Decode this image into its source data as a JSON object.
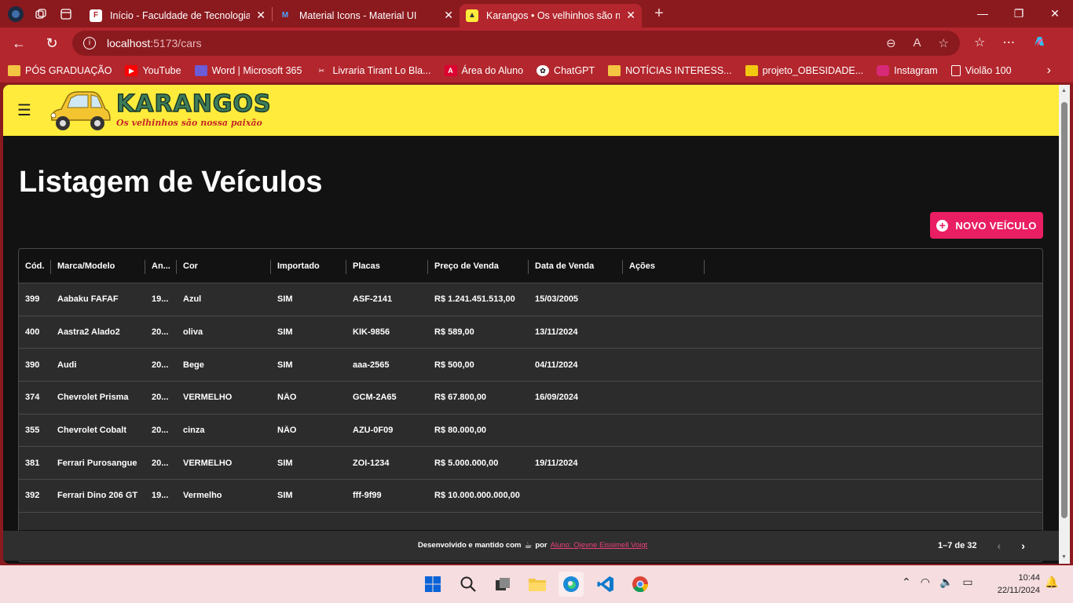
{
  "browser": {
    "tabs": [
      {
        "title": "Início - Faculdade de Tecnologia de",
        "active": false
      },
      {
        "title": "Material Icons - Material UI",
        "active": false
      },
      {
        "title": "Karangos • Os velhinhos são nossa",
        "active": true
      }
    ],
    "url_host": "localhost",
    "url_path": ":5173/cars",
    "bookmarks": [
      "PÓS GRADUAÇÃO",
      "YouTube",
      "Word | Microsoft 365",
      "Livraria Tirant Lo Bla...",
      "Área do Aluno",
      "ChatGPT",
      "NOTÍCIAS INTERESS...",
      "projeto_OBESIDADE...",
      "Instagram",
      "Violão 100"
    ]
  },
  "app": {
    "logo_title": "KARANGOS",
    "logo_slogan": "Os velhinhos são nossa paixão",
    "page_title": "Listagem de Veículos",
    "new_button_label": "NOVO VEÍCULO"
  },
  "grid": {
    "columns": [
      "Cód.",
      "Marca/Modelo",
      "An...",
      "Cor",
      "Importado",
      "Placas",
      "Preço de Venda",
      "Data de Venda",
      "Ações"
    ],
    "rows": [
      {
        "cod": "399",
        "modelo": "Aabaku FAFAF",
        "ano": "19...",
        "cor": "Azul",
        "importado": "SIM",
        "placa": "ASF-2141",
        "preco": "R$ 1.241.451.513,00",
        "data": "15/03/2005"
      },
      {
        "cod": "400",
        "modelo": "Aastra2 Alado2",
        "ano": "20...",
        "cor": "oliva",
        "importado": "SIM",
        "placa": "KIK-9856",
        "preco": "R$ 589,00",
        "data": "13/11/2024"
      },
      {
        "cod": "390",
        "modelo": "Audi",
        "ano": "20...",
        "cor": "Bege",
        "importado": "SIM",
        "placa": "aaa-2565",
        "preco": "R$ 500,00",
        "data": "04/11/2024"
      },
      {
        "cod": "374",
        "modelo": "Chevrolet Prisma",
        "ano": "20...",
        "cor": "VERMELHO",
        "importado": "NÃO",
        "placa": "GCM-2A65",
        "preco": "R$ 67.800,00",
        "data": "16/09/2024"
      },
      {
        "cod": "355",
        "modelo": "Chevrolet Cobalt",
        "ano": "20...",
        "cor": "cinza",
        "importado": "NÃO",
        "placa": "AZU-0F09",
        "preco": "R$ 80.000,00",
        "data": ""
      },
      {
        "cod": "381",
        "modelo": "Ferrari Purosangue",
        "ano": "20...",
        "cor": "VERMELHO",
        "importado": "SIM",
        "placa": "ZOI-1234",
        "preco": "R$ 5.000.000,00",
        "data": "19/11/2024"
      },
      {
        "cod": "392",
        "modelo": "Ferrari Dino 206 GT",
        "ano": "19...",
        "cor": "Vermelho",
        "importado": "SIM",
        "placa": "fff-9f99",
        "preco": "R$ 10.000.000.000,00",
        "data": ""
      }
    ],
    "pagination": "1–7 de 32"
  },
  "footer": {
    "prefix": "Desenvolvido e mantido com",
    "by": "por",
    "author": "Aluno: Ojevne Eissimell Voigt"
  },
  "taskbar": {
    "time": "10:44",
    "date": "22/11/2024"
  },
  "colors": {
    "browser_frame": "#8b1a1f",
    "appbar": "#ffeb3b",
    "accent": "#e91e63",
    "page_bg": "#121212",
    "row_bg": "#2c2c2c"
  }
}
